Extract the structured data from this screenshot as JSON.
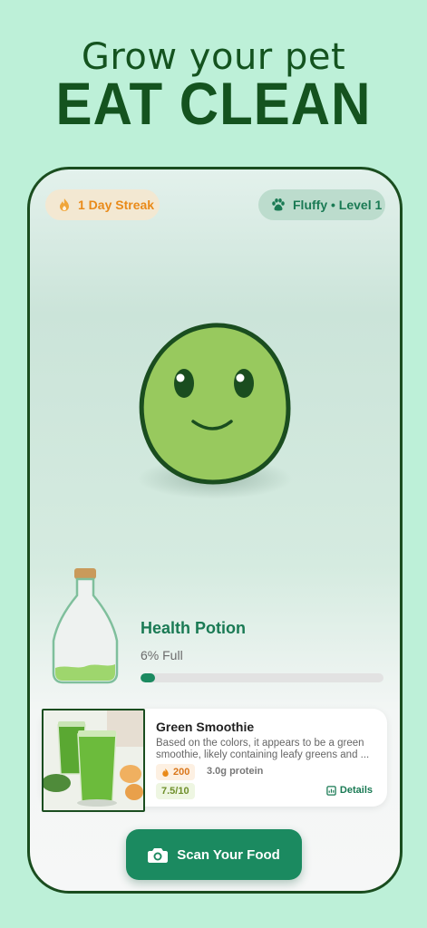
{
  "headline": {
    "line1": "Grow your pet",
    "line2": "EAT CLEAN"
  },
  "status": {
    "streak_label": "1 Day Streak",
    "pet_label": "Fluffy • Level 1"
  },
  "potion": {
    "title": "Health Potion",
    "fill_text": "6% Full",
    "fill_fraction": 0.06
  },
  "food_card": {
    "title": "Green Smoothie",
    "description_line1": "Based on the colors, it appears to be a green",
    "description_line2": "smoothie, likely containing leafy greens and ...",
    "calories": "200",
    "protein": "3.0g protein",
    "score": "7.5/10",
    "details_label": "Details"
  },
  "actions": {
    "scan_label": "Scan Your Food"
  },
  "icons": {
    "streak": "flame-icon",
    "pet": "paw-icon",
    "calories": "flame-icon",
    "details": "document-icon",
    "scan": "camera-icon"
  },
  "colors": {
    "background": "#bdf0d8",
    "brand_green": "#1b8a60",
    "headline_green": "#14531f",
    "streak_orange": "#e98a19",
    "pet_body": "#98c95e",
    "pet_outline": "#1a4d1f"
  }
}
